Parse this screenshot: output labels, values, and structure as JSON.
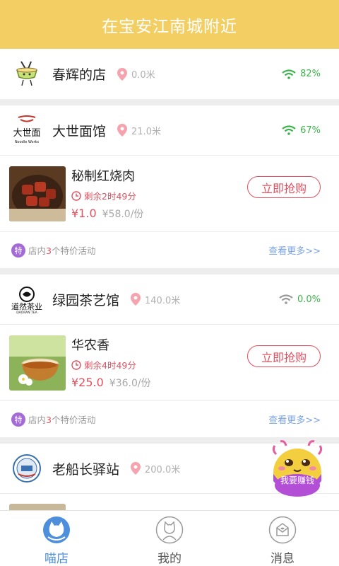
{
  "header": {
    "title": "在宝安江南城附近"
  },
  "colors": {
    "header_bg": "#f3cf63",
    "accent_red": "#e2505f",
    "link_blue": "#7aa3e6",
    "signal_green": "#3cb44b",
    "tab_active": "#4d8fdb"
  },
  "stores": [
    {
      "name": "春辉的店",
      "distance": "0.0米",
      "signal": "82%",
      "logo_icon": "bowl-logo-icon"
    },
    {
      "name": "大世面馆",
      "distance": "21.0米",
      "signal": "67%",
      "logo_icon": "noodle-works-logo-icon",
      "deal": {
        "title": "秘制红烧肉",
        "timer": "剩余2时49分",
        "price_now": "¥1.0",
        "price_old": "¥58.0/份",
        "buy_label": "立即抢购"
      },
      "promo": {
        "prefix": "店内",
        "count": "3",
        "suffix": "个特价活动",
        "badge": "特",
        "more": "查看更多>>"
      }
    },
    {
      "name": "绿园茶艺馆",
      "distance": "140.0米",
      "signal": "0.0%",
      "logo_icon": "tea-logo-icon",
      "deal": {
        "title": "华农香",
        "timer": "剩余4时49分",
        "price_now": "¥25.0",
        "price_old": "¥36.0/份",
        "buy_label": "立即抢购"
      },
      "promo": {
        "prefix": "店内",
        "count": "3",
        "suffix": "个特价活动",
        "badge": "特",
        "more": "查看更多>>"
      }
    },
    {
      "name": "老船长驿站",
      "distance": "200.0米",
      "logo_icon": "captain-logo-icon"
    }
  ],
  "float_button": {
    "label": "我要赚钱"
  },
  "tabs": [
    {
      "label": "喵店",
      "icon": "cat-shop-icon",
      "active": true
    },
    {
      "label": "我的",
      "icon": "profile-cat-icon",
      "active": false
    },
    {
      "label": "消息",
      "icon": "message-icon",
      "active": false
    }
  ]
}
